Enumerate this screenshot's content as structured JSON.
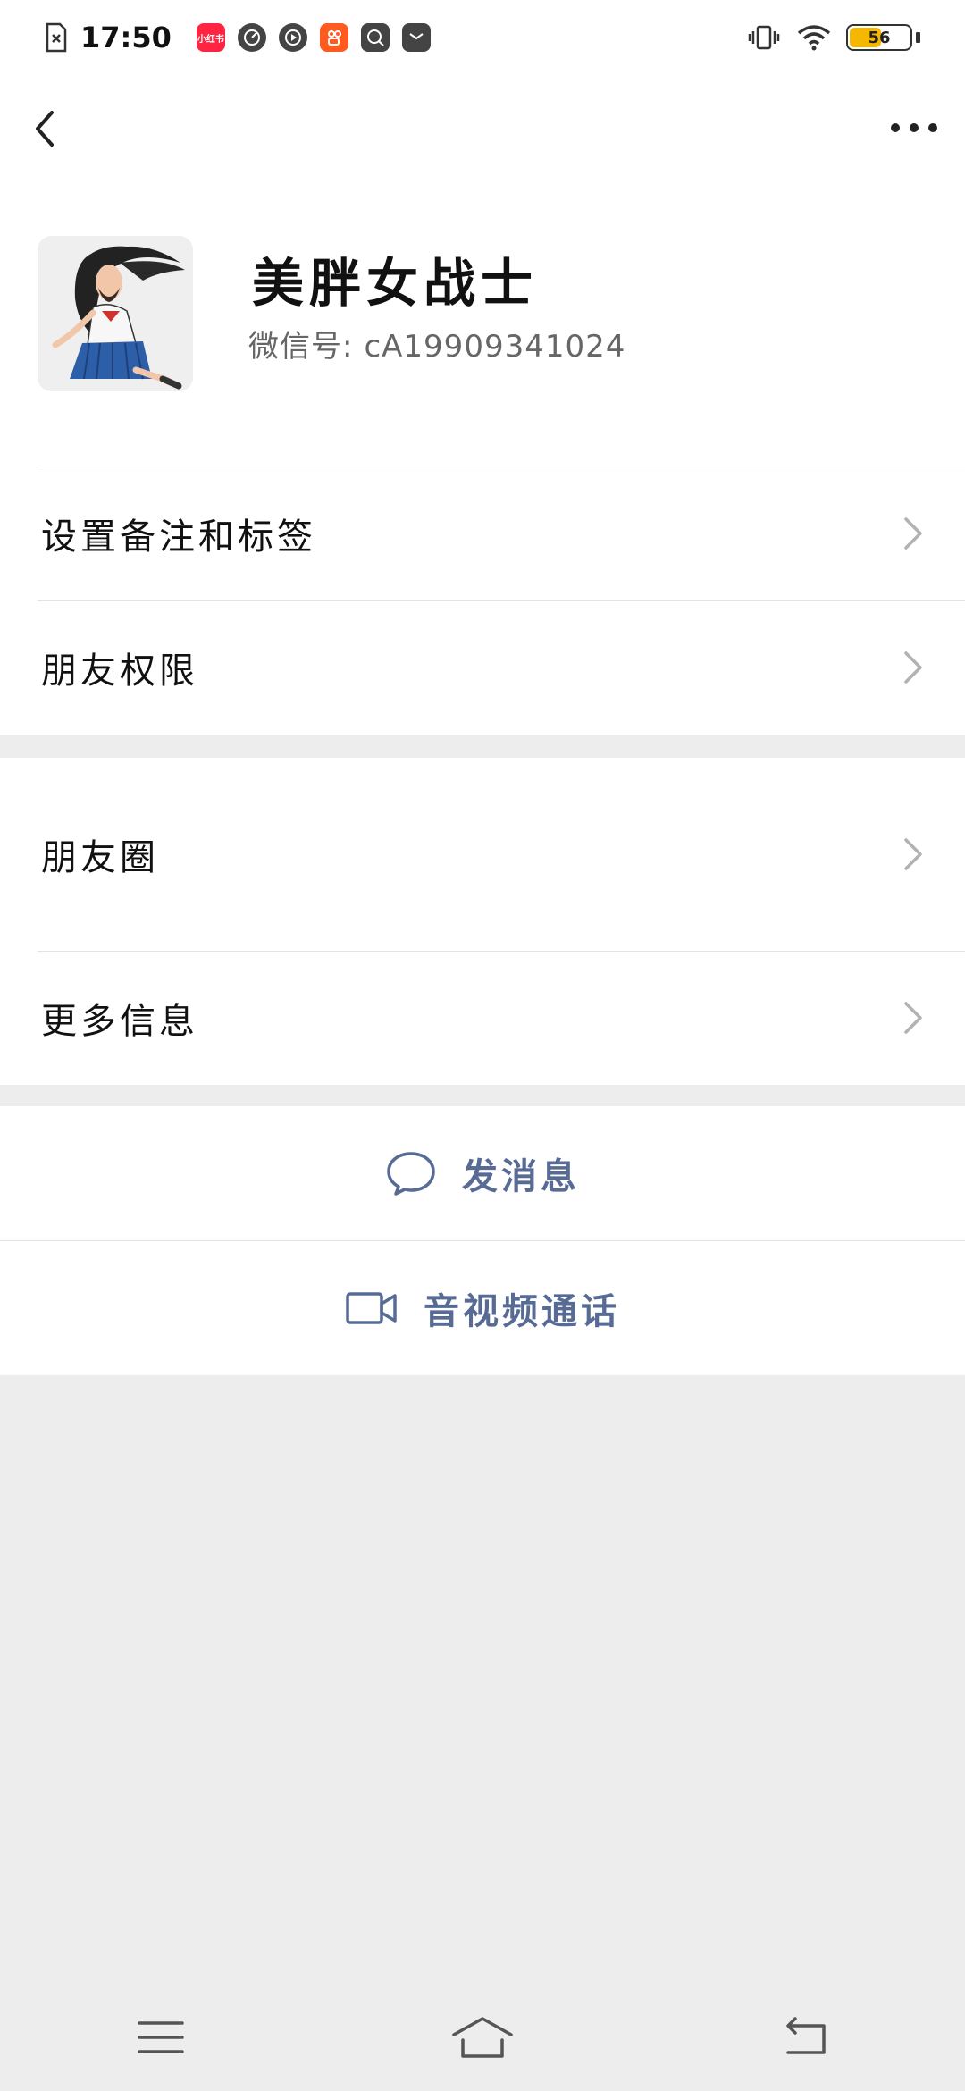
{
  "status_bar": {
    "time": "17:50",
    "app_badges": [
      {
        "name": "sim-icon",
        "color": "#ffffff"
      },
      {
        "name": "xiaohongshu-icon",
        "label": "小红书",
        "color": "#ff2442"
      },
      {
        "name": "speedometer-icon",
        "color": "#444444"
      },
      {
        "name": "play-icon",
        "color": "#444444"
      },
      {
        "name": "kuaishou-icon",
        "color": "#ff5a1f"
      },
      {
        "name": "browser-icon",
        "color": "#444444"
      },
      {
        "name": "mail-icon",
        "color": "#444444"
      }
    ],
    "battery_level": "56",
    "battery_fraction": 0.56,
    "battery_color": "#f5b700"
  },
  "topbar": {
    "back_icon": "chevron-left-icon",
    "more_icon": "more-horizontal-icon"
  },
  "profile": {
    "name": "美胖女战士",
    "wechat_id_prefix": "微信号:",
    "wechat_id": "cA19909341024"
  },
  "menu": {
    "group1": [
      {
        "label": "设置备注和标签"
      },
      {
        "label": "朋友权限"
      }
    ],
    "group2": [
      {
        "label": "朋友圈"
      },
      {
        "label": "更多信息"
      }
    ]
  },
  "actions": {
    "send_message": "发消息",
    "video_call": "音视频通话",
    "accent_color": "#576b95"
  },
  "navbar": {
    "menu_icon": "menu-icon",
    "home_icon": "home-icon",
    "back_icon": "back-icon"
  }
}
